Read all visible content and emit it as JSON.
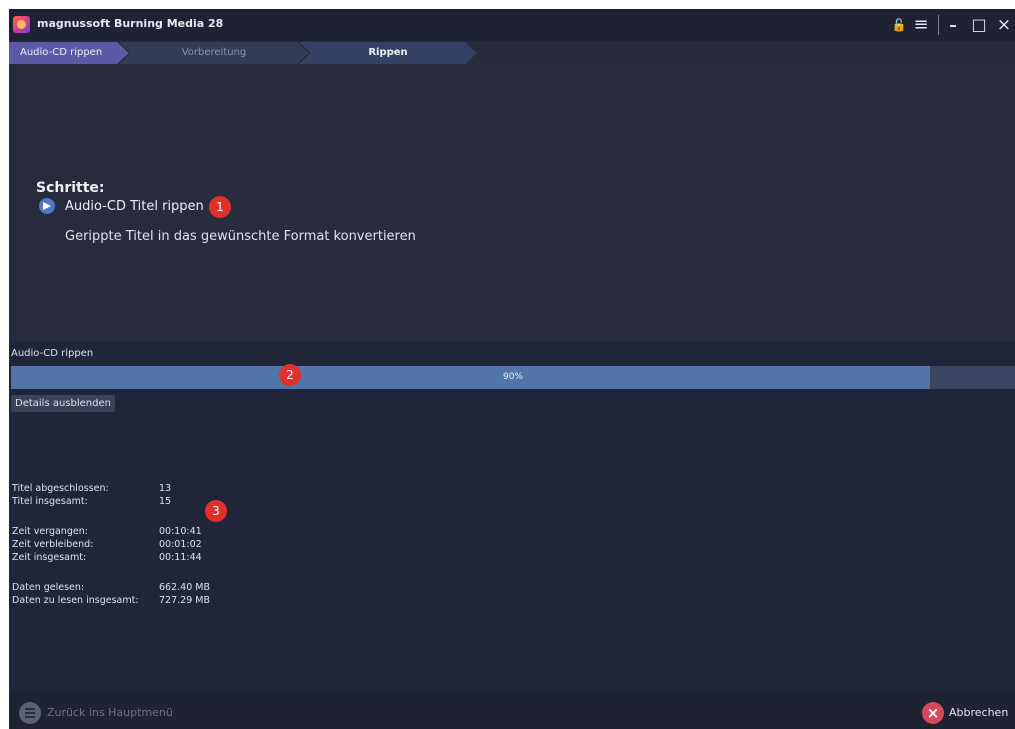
{
  "app": {
    "title": "magnussoft Burning Media 28"
  },
  "window_controls": {
    "lock_icon": "🔓",
    "menu_icon": "≡",
    "minimize_icon": "–",
    "maximize_icon": "□",
    "close_icon": "×"
  },
  "breadcrumb": [
    {
      "label": "Audio-CD rippen"
    },
    {
      "label": "Vorbereitung"
    },
    {
      "label": "Rippen"
    }
  ],
  "steps": {
    "heading": "Schritte:",
    "items": [
      {
        "label": "Audio-CD Titel rippen"
      },
      {
        "label": "Gerippte Titel in das gewünschte Format konvertieren"
      }
    ]
  },
  "badges": [
    "1",
    "2",
    "3"
  ],
  "progress": {
    "label": "Audio-CD rippen",
    "percent_text": "90%",
    "fraction": 0.915,
    "details_button": "Details ausblenden"
  },
  "stats": [
    {
      "label": "Titel abgeschlossen:",
      "value": "13"
    },
    {
      "label": "Titel insgesamt:",
      "value": "15"
    },
    {
      "label": "Zeit vergangen:",
      "value": "00:10:41"
    },
    {
      "label": "Zeit verbleibend:",
      "value": "00:01:02"
    },
    {
      "label": "Zeit insgesamt:",
      "value": "00:11:44"
    },
    {
      "label": "Daten gelesen:",
      "value": "662.40 MB"
    },
    {
      "label": "Daten zu lesen insgesamt:",
      "value": "727.29 MB"
    }
  ],
  "footer": {
    "back_label": "Zurück ins Hauptmenü",
    "cancel_label": "Abbrechen"
  },
  "colors": {
    "background": "#262a3b",
    "accent": "#5d59a6",
    "progress_fill": "#5376a8",
    "badge": "#e0302a",
    "cancel": "#d6495a"
  }
}
